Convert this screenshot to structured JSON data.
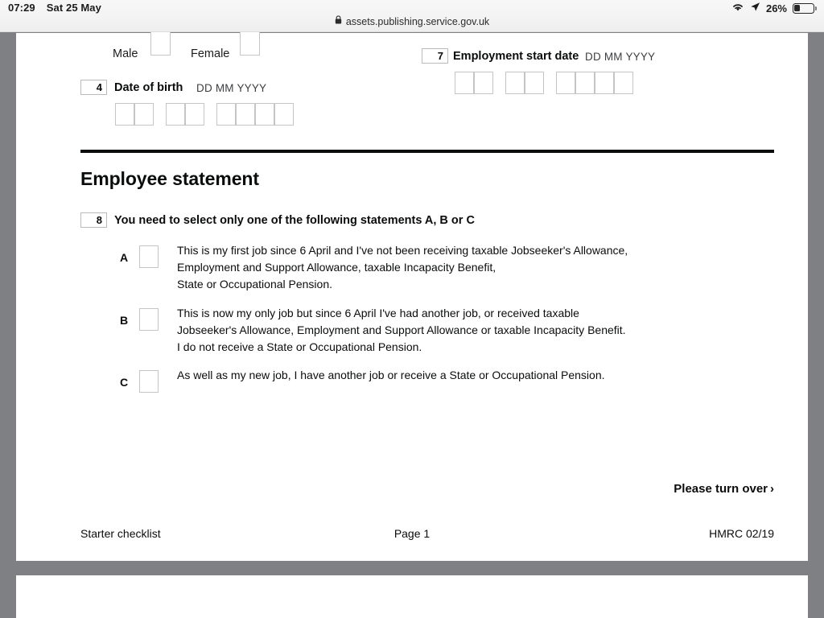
{
  "status_bar": {
    "time": "07:29",
    "date": "Sat 25 May",
    "battery_percent": "26%",
    "wifi_icon": "wifi-icon",
    "location_icon": "location-arrow-icon",
    "battery_icon": "battery-icon"
  },
  "browser": {
    "lock_icon": "lock-icon",
    "url": "assets.publishing.service.gov.uk"
  },
  "form": {
    "gender": {
      "male_label": "Male",
      "female_label": "Female"
    },
    "date_of_birth": {
      "number": "4",
      "label": "Date of birth",
      "hint": "DD MM YYYY",
      "groups": [
        2,
        2,
        4
      ]
    },
    "employment_start_date": {
      "number": "7",
      "label": "Employment start date",
      "hint": "DD MM YYYY",
      "groups": [
        2,
        2,
        4
      ]
    },
    "section_title": "Employee statement",
    "question": {
      "number": "8",
      "text": "You need to select only one of the following statements A, B or C"
    },
    "statements": [
      {
        "letter": "A",
        "lines": [
          "This is my first job since 6 April and I've not been receiving taxable Jobseeker's Allowance,",
          "Employment and Support Allowance, taxable Incapacity Benefit,",
          "State or Occupational Pension."
        ]
      },
      {
        "letter": "B",
        "lines": [
          "This is now my only job but since 6 April I've had another job, or received taxable",
          "Jobseeker's Allowance, Employment and Support Allowance or taxable Incapacity Benefit.",
          "I do not receive a State or Occupational Pension."
        ]
      },
      {
        "letter": "C",
        "lines": [
          "As well as my new job, I have another job or receive a State or Occupational Pension."
        ]
      }
    ],
    "turn_over": "Please turn over",
    "turn_over_chevron": "›",
    "footer": {
      "left": "Starter checklist",
      "center": "Page 1",
      "right": "HMRC 02/19"
    }
  },
  "colors": {
    "page_background": "#7e8083",
    "paper": "#ffffff",
    "ink": "#0b0c0c",
    "box_border": "#c3c5c7",
    "chrome": "#f3f3f3"
  }
}
